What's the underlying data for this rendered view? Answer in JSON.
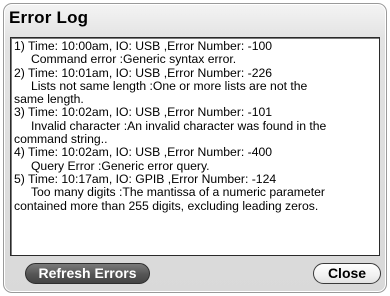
{
  "window": {
    "title": "Error Log"
  },
  "log": {
    "text": "1) Time: 10:00am, IO: USB ,Error Number: -100\n     Command error :Generic syntax error.\n2) Time: 10:01am, IO: USB ,Error Number: -226\n     Lists not same length :One or more lists are not the\nsame length.\n3) Time: 10:02am, IO: USB ,Error Number: -101\n     Invalid character :An invalid character was found in the\ncommand string..\n4) Time: 10:02am, IO: USB ,Error Number: -400\n     Query Error :Generic error query.\n5) Time: 10:17am, IO: GPIB ,Error Number: -124\n     Too many digits :The mantissa of a numeric parameter\ncontained more than 255 digits, excluding leading zeros."
  },
  "buttons": {
    "refresh_label": "Refresh Errors",
    "close_label": "Close"
  }
}
